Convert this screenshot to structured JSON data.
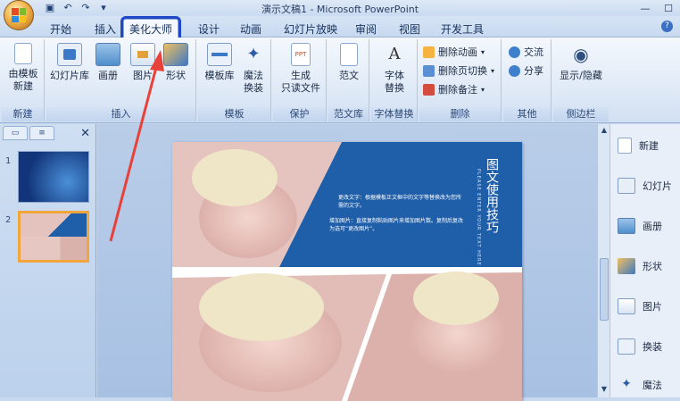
{
  "window": {
    "title": "演示文稿1 - Microsoft PowerPoint"
  },
  "tabs": [
    {
      "label": "开始"
    },
    {
      "label": "插入"
    },
    {
      "label": "美化大师"
    },
    {
      "label": "设计"
    },
    {
      "label": "动画"
    },
    {
      "label": "幻灯片放映"
    },
    {
      "label": "审阅"
    },
    {
      "label": "视图"
    },
    {
      "label": "开发工具"
    }
  ],
  "ribbon": {
    "groups": {
      "new": {
        "label": "新建",
        "btn_line1": "由模板",
        "btn_line2": "新建"
      },
      "insert": {
        "label": "插入",
        "slides": "幻灯片库",
        "album": "画册",
        "picture": "图片",
        "shape": "形状"
      },
      "template": {
        "label": "模板",
        "library": "模板库",
        "magic1": "魔法",
        "magic2": "换装"
      },
      "protect": {
        "label": "保护",
        "gen1": "生成",
        "gen2": "只读文件"
      },
      "fanwen": {
        "label": "范文库",
        "btn": "范文"
      },
      "font": {
        "label": "字体替换",
        "btn1": "字体",
        "btn2": "替换"
      },
      "delete": {
        "label": "删除",
        "anim": "删除动画",
        "footer": "删除页切换",
        "notes": "删除备注"
      },
      "other": {
        "label": "其他",
        "exchange": "交流",
        "share": "分享"
      },
      "sidebar": {
        "label": "侧边栏",
        "btn": "显示/隐藏"
      }
    }
  },
  "slides": [
    {
      "num": "1"
    },
    {
      "num": "2"
    }
  ],
  "slide": {
    "title_vertical": "图文使用技巧",
    "sub_vertical": "PLEASE ENTER YOUR TEXT HERE",
    "para1": "更改文字：根据模板正文框中的文字等替换改为您所需的文字。",
    "para2": "增加图片：直接复制粘贴图片来增加图片数。复制后复改为选可“更改图片”。"
  },
  "right_panel": [
    {
      "label": "新建"
    },
    {
      "label": "幻灯片"
    },
    {
      "label": "画册"
    },
    {
      "label": "形状"
    },
    {
      "label": "图片"
    },
    {
      "label": "换装"
    },
    {
      "label": "魔法"
    }
  ],
  "colors": {
    "highlight_box": "#1f47c9",
    "slide_blue": "#1f5fa9",
    "arrow_red": "#e8413a"
  }
}
